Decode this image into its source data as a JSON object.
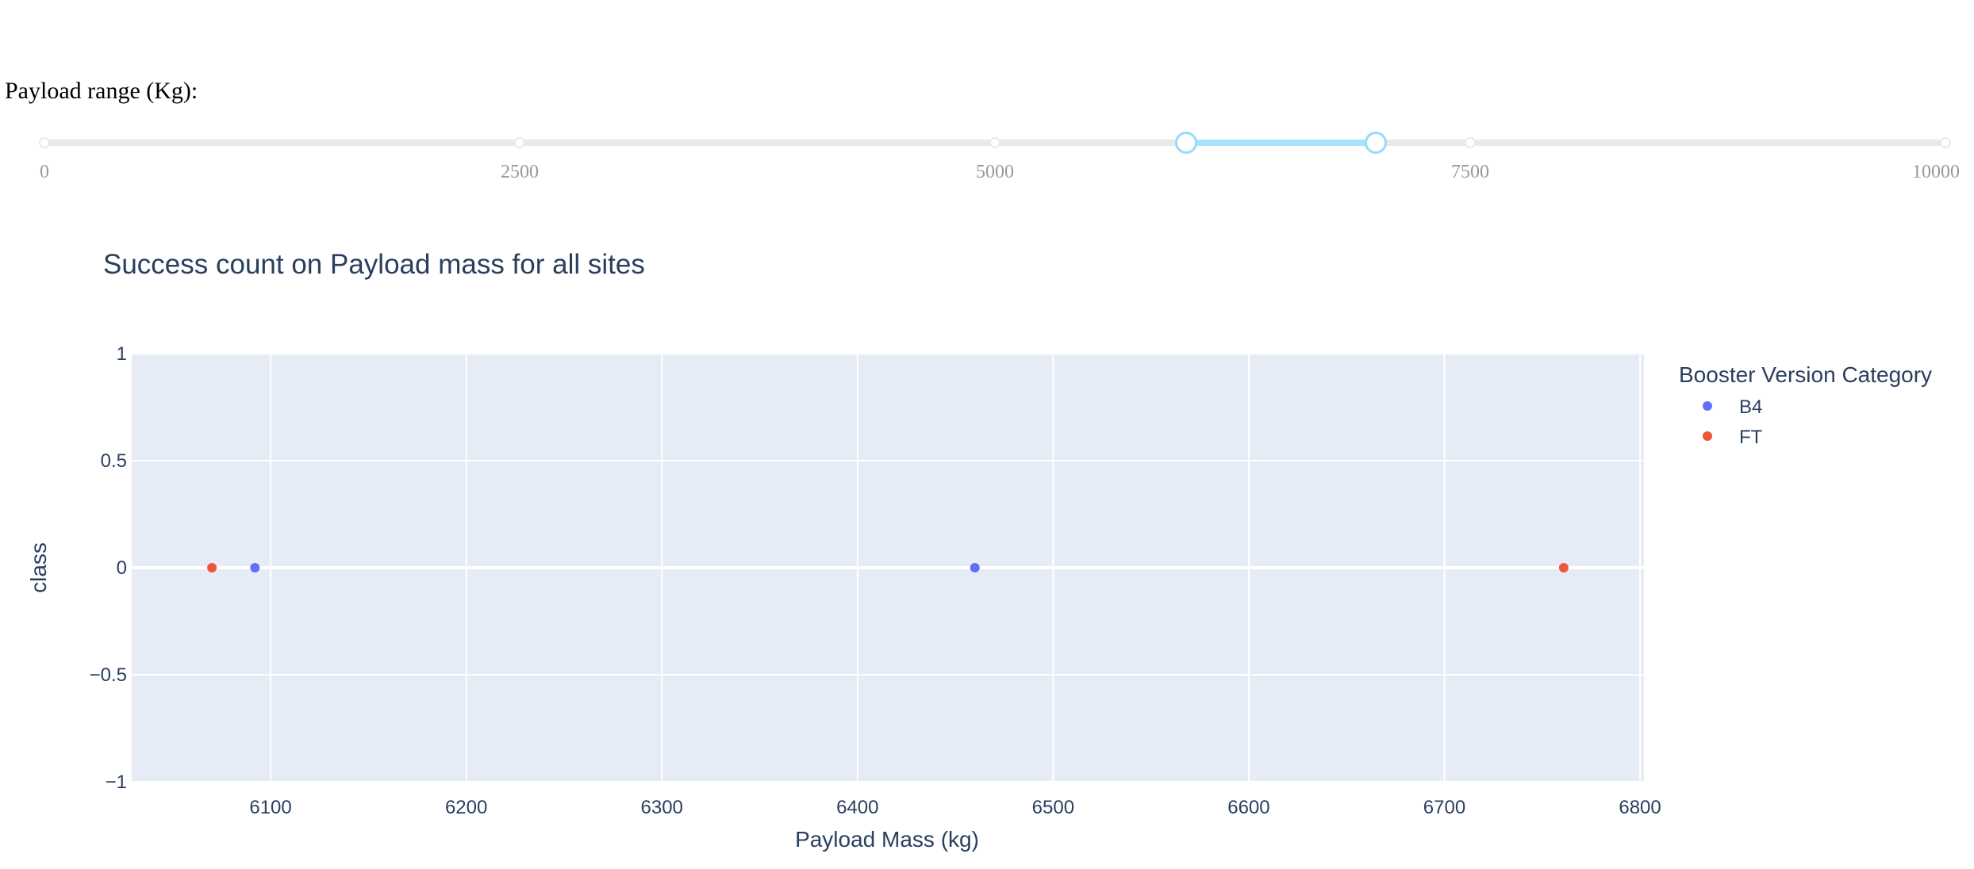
{
  "slider": {
    "label": "Payload range (Kg):",
    "min": 0,
    "max": 10000,
    "selected_range": [
      6000,
      7000
    ],
    "marks": [
      "0",
      "2500",
      "5000",
      "7500",
      "10000"
    ],
    "mark_values": [
      0,
      2500,
      5000,
      7500,
      10000
    ],
    "accent_color": "#96dbfa",
    "track_color": "#abe2fb",
    "rail_color": "#e9e9e9"
  },
  "chart_data": {
    "type": "scatter",
    "title": "Success count on Payload mass for all sites",
    "xlabel": "Payload Mass (kg)",
    "ylabel": "class",
    "xlim": [
      6029,
      6802
    ],
    "ylim": [
      -1,
      1
    ],
    "x_ticks": [
      6100,
      6200,
      6300,
      6400,
      6500,
      6600,
      6700,
      6800
    ],
    "y_ticks": [
      1,
      0.5,
      0,
      -0.5,
      -1
    ],
    "y_tick_labels": [
      "1",
      "0.5",
      "0",
      "−0.5",
      "−1"
    ],
    "grid": true,
    "legend_title": "Booster Version Category",
    "legend_position": "right",
    "plot_background": "#e5ecf6",
    "series": [
      {
        "name": "B4",
        "color": "#636efa",
        "points": [
          {
            "x": 6092,
            "y": 0
          },
          {
            "x": 6460,
            "y": 0
          }
        ]
      },
      {
        "name": "FT",
        "color": "#ef553b",
        "points": [
          {
            "x": 6070,
            "y": 0
          },
          {
            "x": 6761,
            "y": 0
          }
        ]
      }
    ]
  }
}
